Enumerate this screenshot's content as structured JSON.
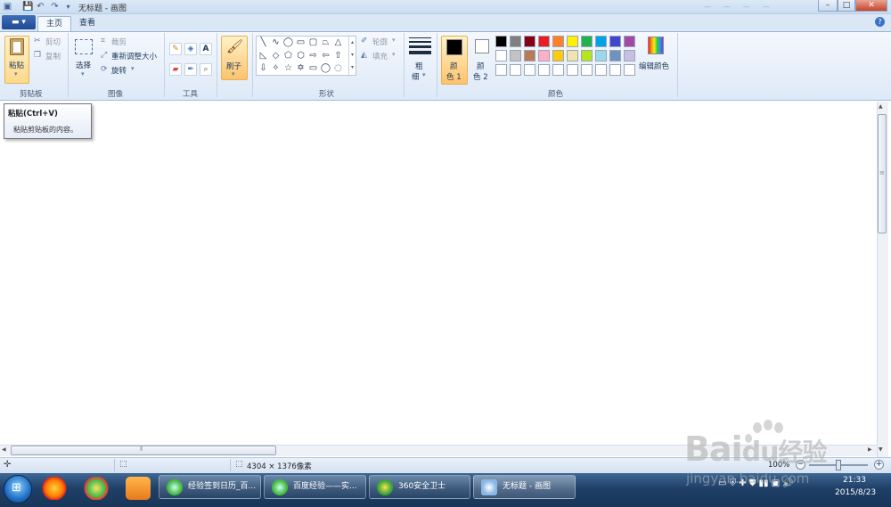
{
  "titlebar": {
    "title": "无标题 - 画图",
    "menu_items": [
      "—",
      "—",
      "—",
      "—",
      "—",
      "—"
    ],
    "min": "–",
    "max": "□",
    "close": "✕"
  },
  "tabs": {
    "app_menu": "▬ ▾",
    "home": "主页",
    "view": "查看",
    "help": "?"
  },
  "clipboard": {
    "paste": "粘贴",
    "cut": "剪切",
    "copy": "复制",
    "group": "剪贴板"
  },
  "image": {
    "select": "选择",
    "crop": "裁剪",
    "resize": "重新调整大小",
    "rotate": "旋转",
    "group": "图像"
  },
  "tools": {
    "group": "工具",
    "text_icon": "A"
  },
  "brushes": {
    "label": "刷子"
  },
  "shapes": {
    "outline": "轮廓",
    "fill": "填充",
    "group": "形状"
  },
  "size": {
    "label1": "粗",
    "label2": "细"
  },
  "colors": {
    "color1_a": "颜",
    "color1_b": "色 1",
    "color2_a": "颜",
    "color2_b": "色 2",
    "edit": "编辑颜色",
    "group": "颜色",
    "palette_row1": [
      "#000000",
      "#7f7f7f",
      "#880015",
      "#ed1c24",
      "#ff7f27",
      "#fff200",
      "#22b14c",
      "#00a2e8",
      "#3f48cc",
      "#a349a4"
    ],
    "palette_row2": [
      "#ffffff",
      "#c3c3c3",
      "#b97a57",
      "#ffaec9",
      "#ffc90e",
      "#efe4b0",
      "#b5e61d",
      "#99d9ea",
      "#7092be",
      "#c8bfe7"
    ],
    "palette_row3": [
      "#ffffff",
      "#ffffff",
      "#ffffff",
      "#ffffff",
      "#ffffff",
      "#ffffff",
      "#ffffff",
      "#ffffff",
      "#ffffff",
      "#ffffff"
    ]
  },
  "tooltip": {
    "title": "粘贴(Ctrl+V)",
    "desc": "粘贴剪贴板的内容。"
  },
  "statusbar": {
    "dimensions": "4304 × 1376像素",
    "zoom": "100%"
  },
  "taskbar": {
    "tasks": [
      "经验签到日历_百...",
      "百度经验——实...",
      "360安全卫士",
      "无标题 - 画图"
    ],
    "time": "21:33",
    "date": "2015/8/23"
  },
  "watermark": {
    "brand_left": "Bai",
    "brand_right": "du",
    "brand_cn": "经验",
    "url": "jingyan.baidu.com"
  }
}
